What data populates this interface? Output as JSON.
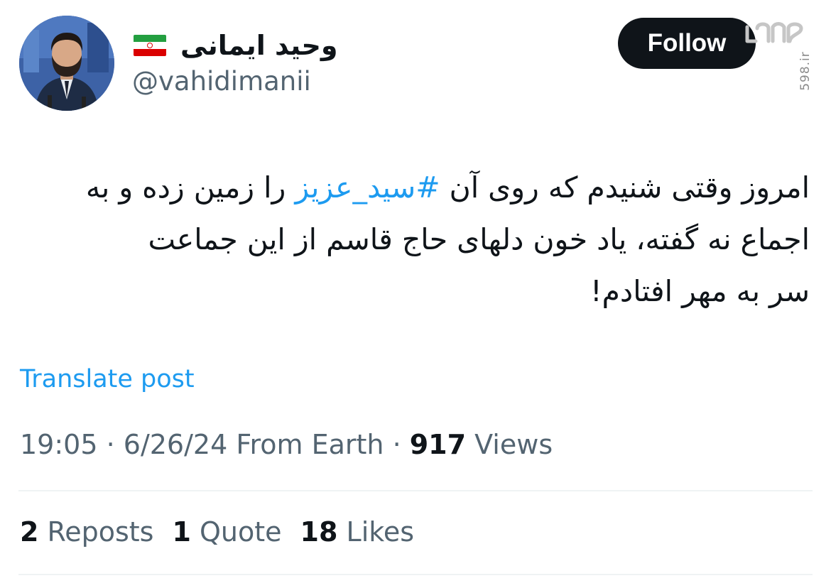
{
  "user": {
    "display_name": "وحید ایمانی",
    "handle": "@vahidimanii",
    "flag_icon": "iran-flag-icon",
    "follow_label": "Follow"
  },
  "watermark": {
    "site": "598.ir"
  },
  "tweet": {
    "line1_pre": "امروز وقتی شنیدم که روی آن ",
    "hashtag": "#سید_عزیز",
    "line1_post": " را زمین زده و به",
    "line2": "اجماع نه گفته، یاد خون دلهای حاج قاسم از این جماعت",
    "line3": "سر به مهر افتادم!"
  },
  "translate_label": "Translate post",
  "meta": {
    "time": "19:05",
    "sep1": " · ",
    "date": "6/26/24",
    "source": " From Earth",
    "sep2": " · ",
    "views_count": "917",
    "views_label": " Views"
  },
  "stats": {
    "reposts_count": "2",
    "reposts_label": " Reposts",
    "quotes_count": "1",
    "quotes_label": " Quote",
    "likes_count": "18",
    "likes_label": " Likes"
  },
  "colors": {
    "link_blue": "#1d9bf0",
    "text": "#0f1419",
    "muted": "#536471",
    "button_bg": "#0f1419"
  }
}
